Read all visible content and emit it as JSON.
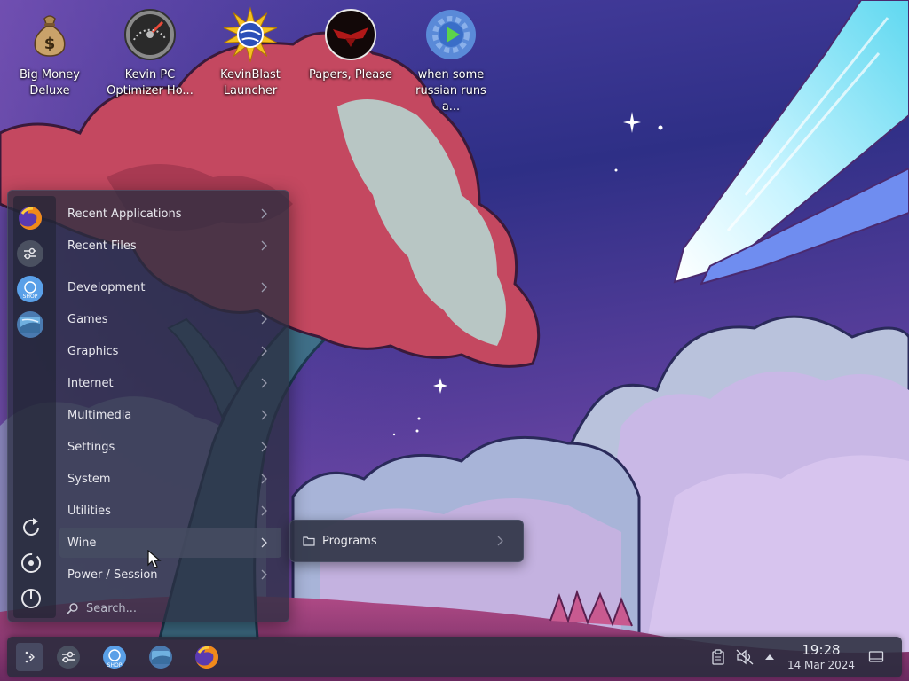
{
  "desktop": {
    "icons": [
      {
        "label": "Big Money\nDeluxe",
        "icon": "money-bag-icon"
      },
      {
        "label": "Kevin PC\nOptimizer Ho...",
        "icon": "speedometer-icon"
      },
      {
        "label": "KevinBlast\nLauncher",
        "icon": "sun-globe-icon"
      },
      {
        "label": "Papers, Please",
        "icon": "eagle-emblem-icon"
      },
      {
        "label": "when some\nrussian runs a...",
        "icon": "play-gear-icon"
      }
    ]
  },
  "app_menu": {
    "favorites": [
      "firefox-icon",
      "settings-manager-icon",
      "store-icon",
      "terminal-icon"
    ],
    "categories": [
      {
        "label": "Recent Applications"
      },
      {
        "label": "Recent Files"
      },
      {
        "label": "Development"
      },
      {
        "label": "Games"
      },
      {
        "label": "Graphics"
      },
      {
        "label": "Internet"
      },
      {
        "label": "Multimedia"
      },
      {
        "label": "Settings"
      },
      {
        "label": "System"
      },
      {
        "label": "Utilities"
      },
      {
        "label": "Wine",
        "active": true
      },
      {
        "label": "Power / Session"
      }
    ],
    "search_placeholder": "Search...",
    "rail_actions": [
      "restart-icon",
      "logout-icon",
      "power-icon"
    ]
  },
  "submenu": {
    "items": [
      {
        "label": "Programs",
        "icon": "folder-icon"
      }
    ]
  },
  "taskbar": {
    "pinned": [
      "launcher-icon",
      "settings-manager-icon",
      "store-icon",
      "terminal-icon",
      "firefox-icon"
    ],
    "tray": [
      "clipboard-icon",
      "volume-muted-icon",
      "tray-expand-icon"
    ],
    "clock": {
      "time": "19:28",
      "date": "14 Mar 2024"
    }
  },
  "colors": {
    "menu_bg": "#2a2e40",
    "active_item": "#464c62",
    "taskbar_bg": "#2a2c3e",
    "sky_top": "#2b2d78",
    "sky_bottom": "#7a4fb8"
  }
}
